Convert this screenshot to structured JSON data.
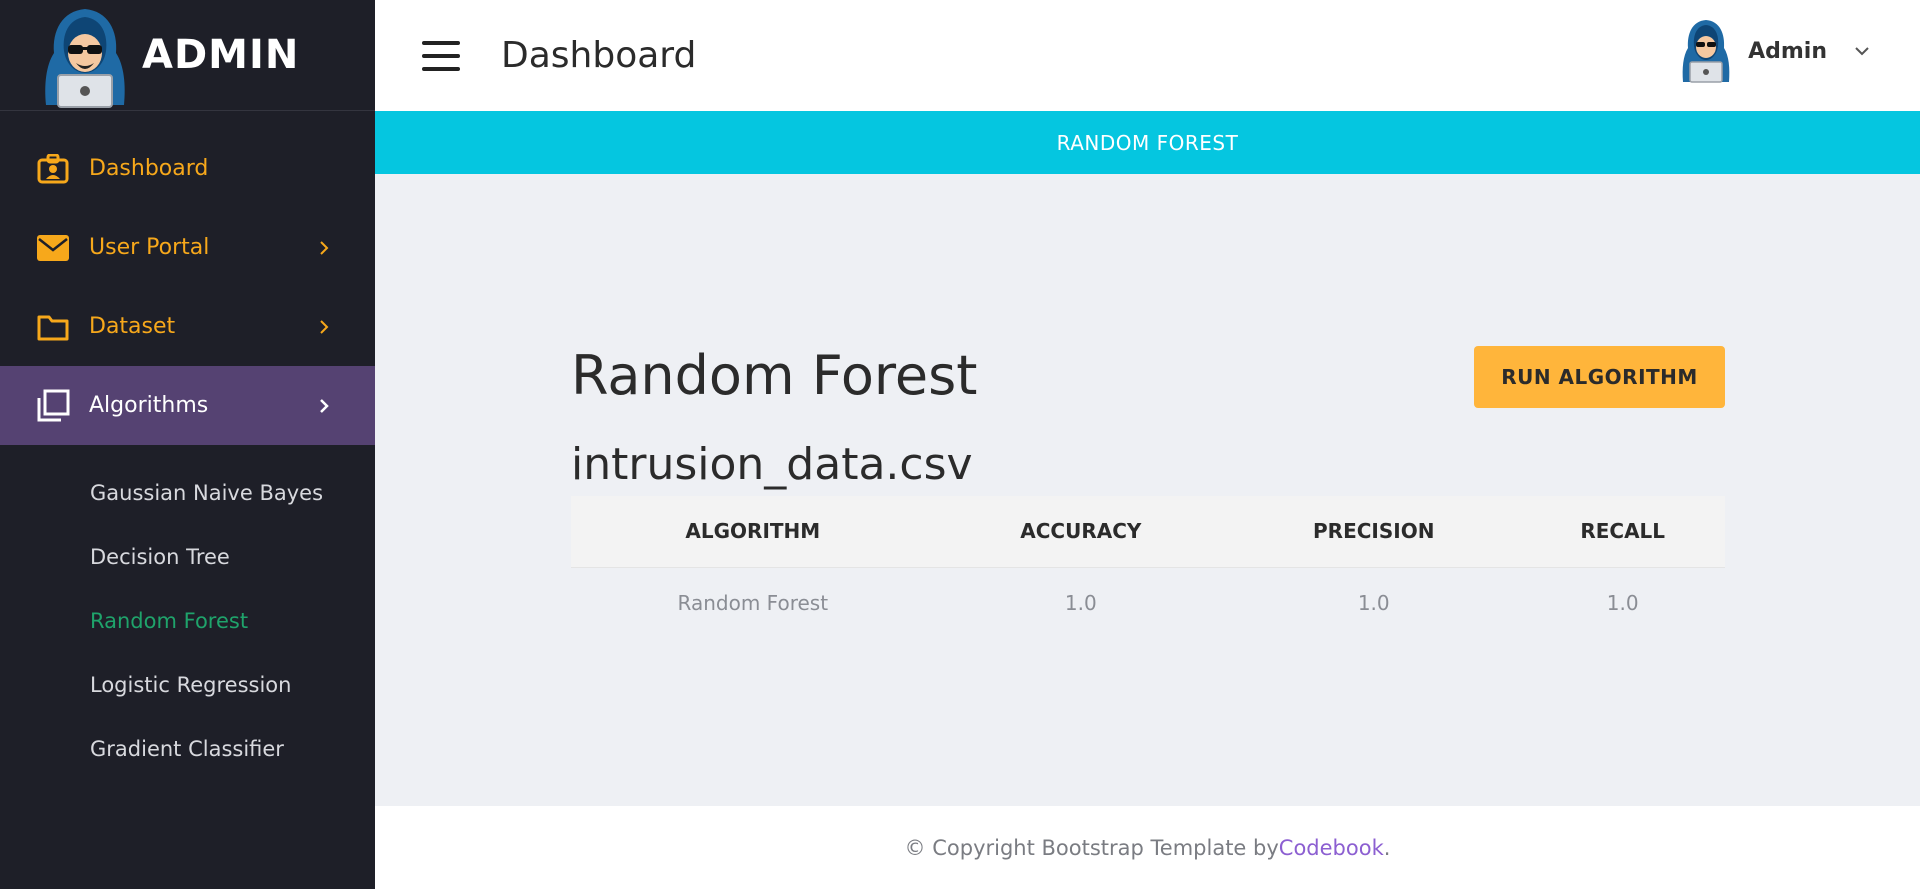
{
  "brand": {
    "name": "ADMIN",
    "logo_icon": "hacker-avatar-icon"
  },
  "sidebar": {
    "items": [
      {
        "label": "Dashboard",
        "icon": "id-badge-icon",
        "has_chevron": false
      },
      {
        "label": "User Portal",
        "icon": "envelope-icon",
        "has_chevron": true
      },
      {
        "label": "Dataset",
        "icon": "folder-icon",
        "has_chevron": true
      },
      {
        "label": "Algorithms",
        "icon": "copy-icon",
        "has_chevron": true,
        "active": true
      }
    ],
    "subitems": [
      {
        "label": "Gaussian Naive Bayes"
      },
      {
        "label": "Decision Tree"
      },
      {
        "label": "Random Forest",
        "current": true
      },
      {
        "label": "Logistic Regression"
      },
      {
        "label": "Gradient Classifier"
      }
    ]
  },
  "header": {
    "title": "Dashboard",
    "user_name": "Admin",
    "menu_icon": "hamburger-icon",
    "user_chevron_icon": "chevron-down-icon"
  },
  "banner": {
    "text": "RANDOM FOREST"
  },
  "main": {
    "algorithm_title": "Random Forest",
    "run_button_label": "RUN ALGORITHM",
    "dataset_name": "intrusion_data.csv",
    "table": {
      "headers": [
        "ALGORITHM",
        "ACCURACY",
        "PRECISION",
        "RECALL"
      ],
      "rows": [
        [
          "Random Forest",
          "1.0",
          "1.0",
          "1.0"
        ]
      ]
    }
  },
  "footer": {
    "prefix": "© Copyright Bootstrap Template by ",
    "link": "Codebook",
    "suffix": "."
  },
  "colors": {
    "sidebar_bg": "#1e1f28",
    "accent_orange": "#f7a81b",
    "active_item_bg": "#554272",
    "current_subitem": "#1fa36b",
    "banner_bg": "#05c6e0",
    "run_button_bg": "#ffb53b",
    "footer_link": "#8c5fd1"
  }
}
